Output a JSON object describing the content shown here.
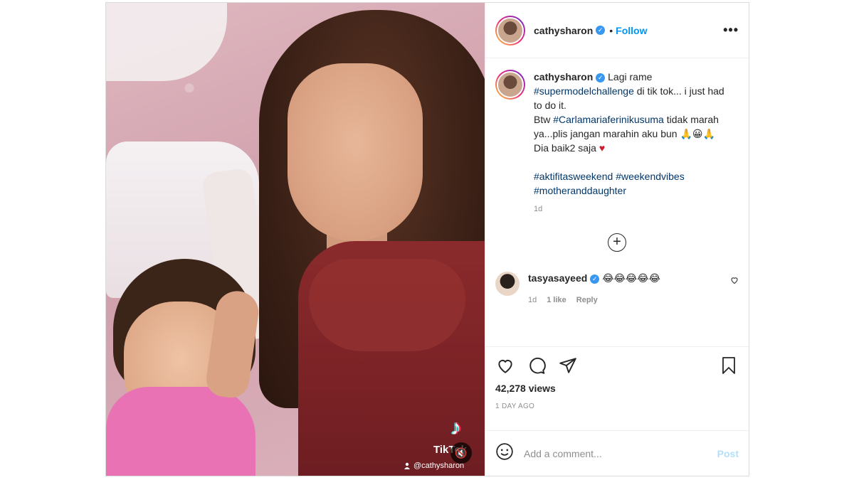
{
  "post": {
    "author": "cathysharon",
    "follow_label": "Follow",
    "dot": "•",
    "more_options": "•••",
    "caption": {
      "line1": "Lagi rame",
      "tag1": "#supermodelchallenge",
      "line2": " di tik tok... i just had to do it.",
      "line3a": "Btw ",
      "tag2": "#Carlamariaferinikusuma",
      "line3b": " tidak marah ya...plis jangan marahin aku bun 🙏😀🙏",
      "line4": "Dia baik2 saja ",
      "heart": "♥",
      "tag3": "#aktifitasweekend",
      "tag4": "#weekendvibes",
      "tag5": "#motheranddaughter"
    },
    "caption_age": "1d",
    "load_more": "+"
  },
  "comment": {
    "author": "tasyasayeed",
    "text": "😂😂😂😂😂",
    "age": "1d",
    "likes": "1 like",
    "reply": "Reply"
  },
  "media": {
    "tiktok_word": "TikTok",
    "tiktok_handle": "@cathysharon",
    "mute_icon": "🔇"
  },
  "stats": {
    "views": "42,278 views",
    "time_ago": "1 DAY AGO"
  },
  "composer": {
    "placeholder": "Add a comment...",
    "post_label": "Post"
  },
  "colors": {
    "link": "#0095f6",
    "hashtag": "#00376b",
    "verified": "#3897f0"
  }
}
